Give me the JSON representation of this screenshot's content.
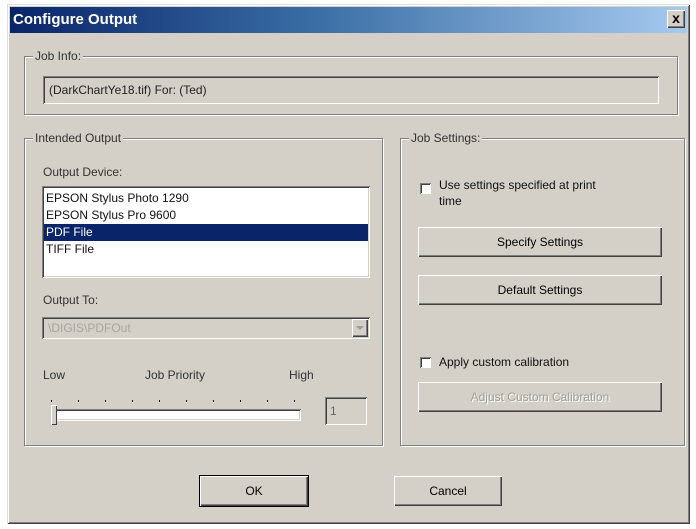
{
  "window": {
    "title": "Configure Output",
    "close_glyph": "x"
  },
  "job_info": {
    "legend": "Job Info:",
    "value": "(DarkChartYe18.tif) For: (Ted)"
  },
  "intended_output": {
    "legend": "Intended Output",
    "device_label": "Output Device:",
    "devices": [
      "EPSON Stylus Photo 1290",
      "EPSON Stylus Pro 9600",
      "PDF File",
      "TIFF File"
    ],
    "selected_device": "PDF File",
    "output_to_label": "Output To:",
    "output_to_value": "\\DIGIS\\PDFOut",
    "priority_low": "Low",
    "priority_label": "Job Priority",
    "priority_high": "High",
    "priority_value": "1"
  },
  "job_settings": {
    "legend": "Job Settings:",
    "use_settings_label": "Use settings specified at print time",
    "use_settings_checked": false,
    "specify_button": "Specify Settings",
    "default_button": "Default Settings",
    "calibration_label": "Apply custom calibration",
    "calibration_checked": false,
    "adjust_button": "Adjust Custom Calibration"
  },
  "buttons": {
    "ok": "OK",
    "cancel": "Cancel"
  },
  "icons": {
    "dropdown": "chevron-down-icon",
    "close": "close-icon"
  }
}
